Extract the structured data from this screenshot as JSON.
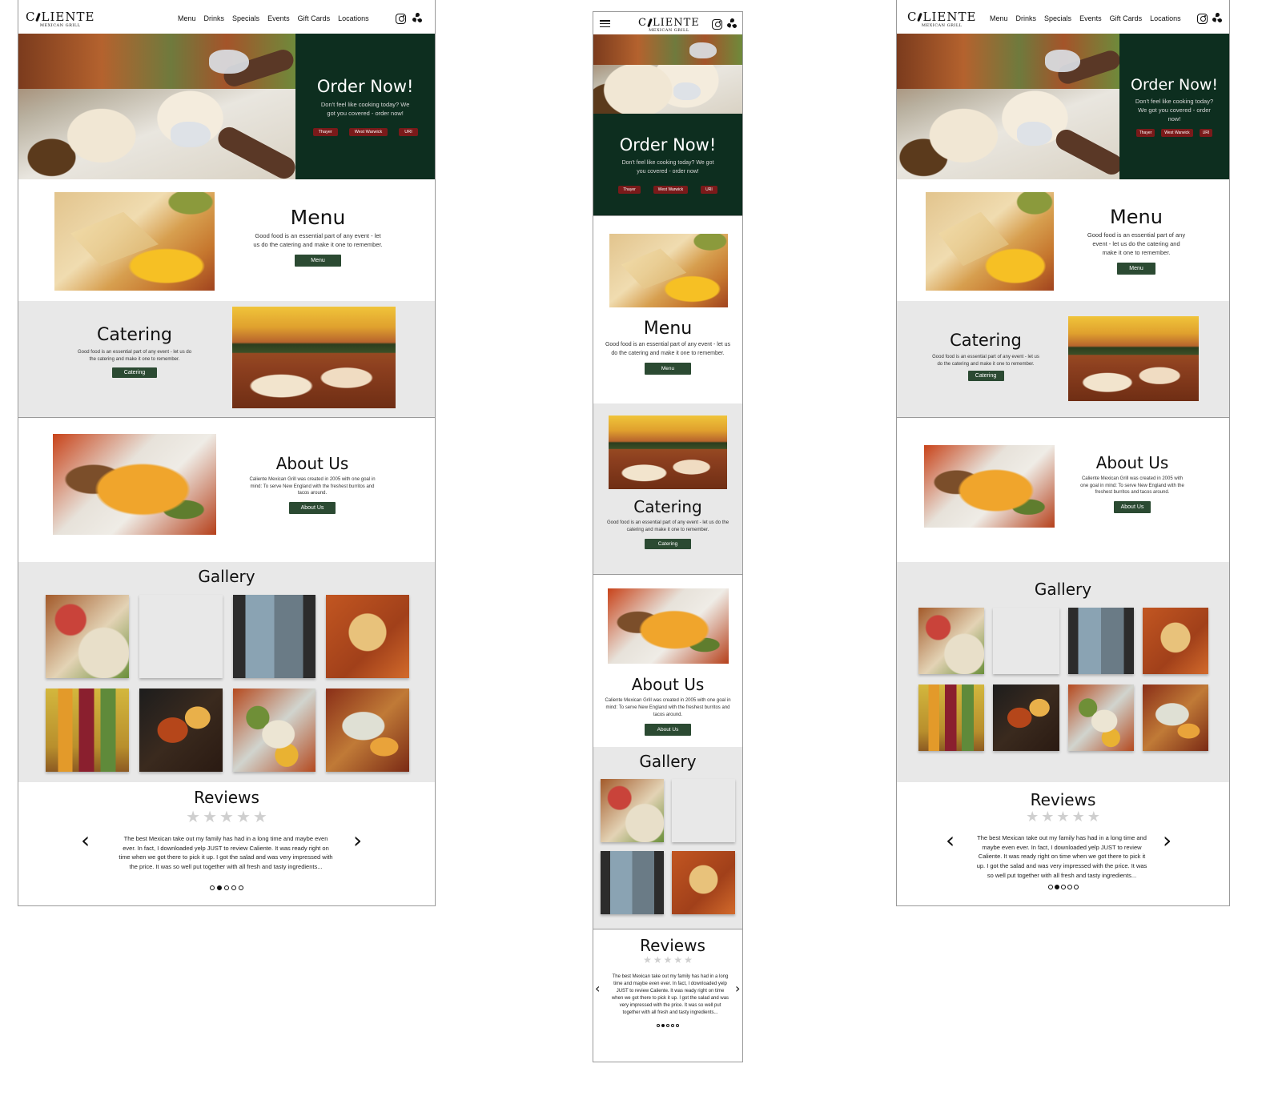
{
  "brand": {
    "name_pre": "C",
    "name_post": "LIENTE",
    "sub": "MEXICAN GRILL"
  },
  "nav": {
    "links": [
      "Menu",
      "Drinks",
      "Specials",
      "Events",
      "Gift Cards",
      "Locations"
    ]
  },
  "hero": {
    "title": "Order Now!",
    "text": "Don't feel like cooking today? We got you covered - order now!",
    "locations": [
      "Thayer",
      "West Warwick",
      "URI"
    ]
  },
  "menu": {
    "title": "Menu",
    "text": "Good food is an essential part of any event - let us do the catering and make it one to remember.",
    "button": "Menu"
  },
  "catering": {
    "title": "Catering",
    "text": "Good food is an essential part of any event - let us do the catering and make it one to remember.",
    "button": "Catering"
  },
  "about": {
    "title": "About Us",
    "text": "Caliente Mexican Grill was created in 2005 with one goal in mind: To serve New England with the freshest burritos and tacos around.",
    "button": "About Us"
  },
  "gallery": {
    "title": "Gallery",
    "images": [
      "g1",
      "g2",
      "g3",
      "g4",
      "g5",
      "g6",
      "g7",
      "g8"
    ]
  },
  "reviews": {
    "title": "Reviews",
    "stars": 5,
    "text": "The best Mexican take out my family has had in a long time and maybe even ever. In fact, I downloaded yelp JUST to review Caliente. It was ready right on time when we got there to pick it up. I got the salad and was very impressed with the price. It was so well put together with all fresh and tasty ingredients...",
    "prev_icon": "chevron-left-icon",
    "next_icon": "chevron-right-icon",
    "dots": 5,
    "active_dot": 1
  },
  "colors": {
    "order_bg": "#0d2e1f",
    "button": "#2b4a32",
    "location_btn": "#7a1a1a",
    "grey_section": "#e8e8e8"
  }
}
